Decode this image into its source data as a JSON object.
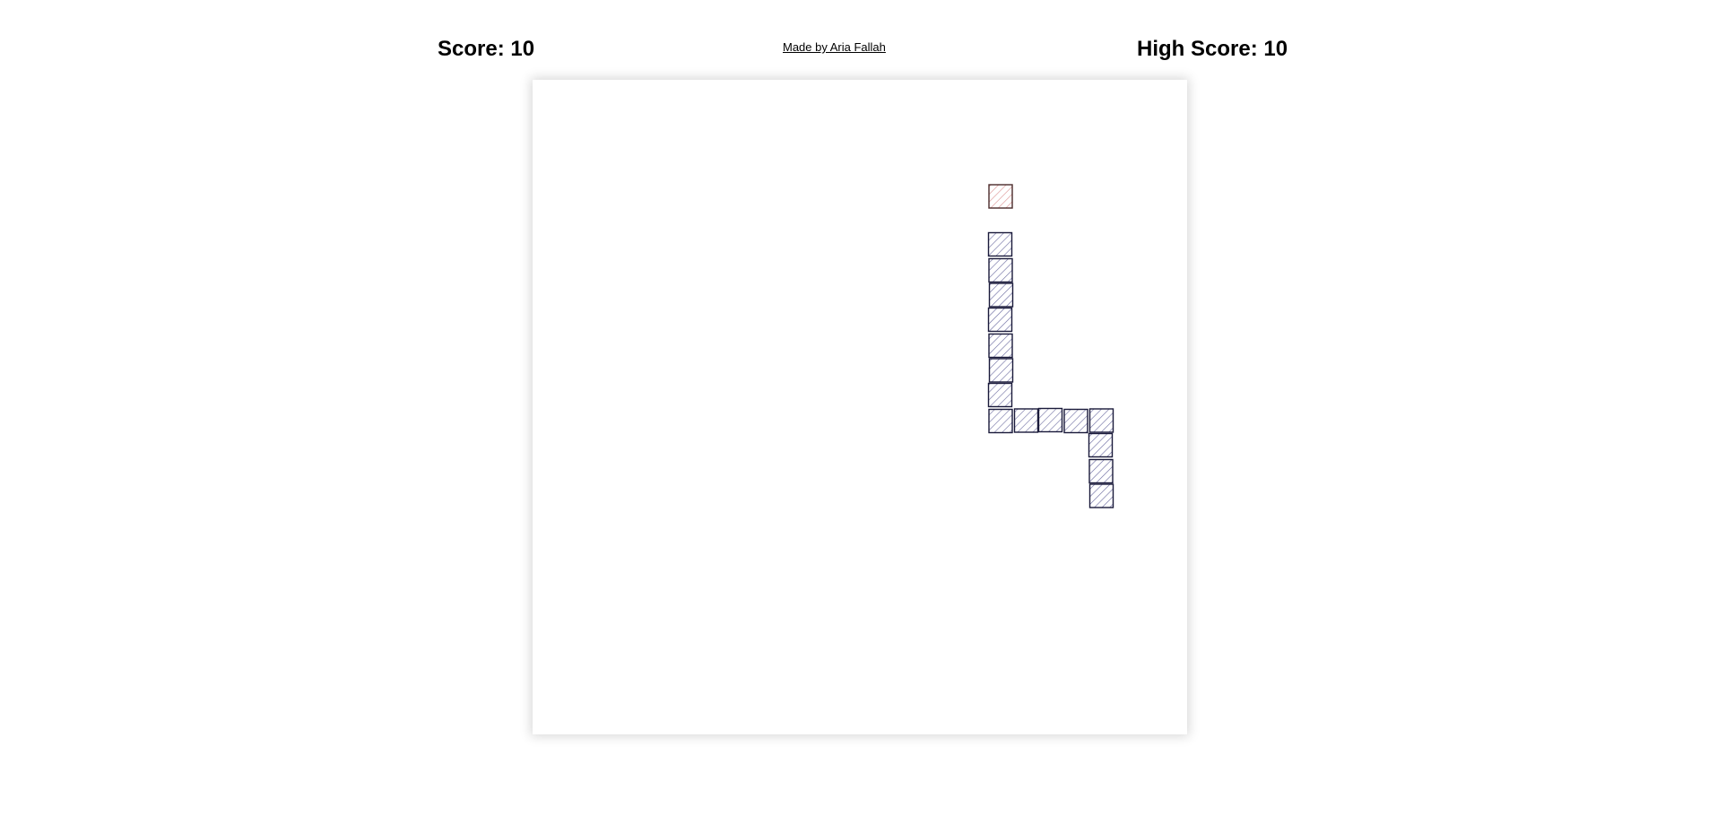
{
  "header": {
    "score_text": "Score: 10",
    "credit_text": "Made by Aria Fallah",
    "high_score_text": "High Score: 10"
  },
  "game": {
    "score": 10,
    "high_score": 10,
    "colors": {
      "snake_stroke": "#1a1a3a",
      "snake_hatch": "#6a6aa0",
      "food_stroke": "#4a2a2a",
      "food_hatch": "#d98a8a",
      "board_background": "#ffffff"
    }
  }
}
